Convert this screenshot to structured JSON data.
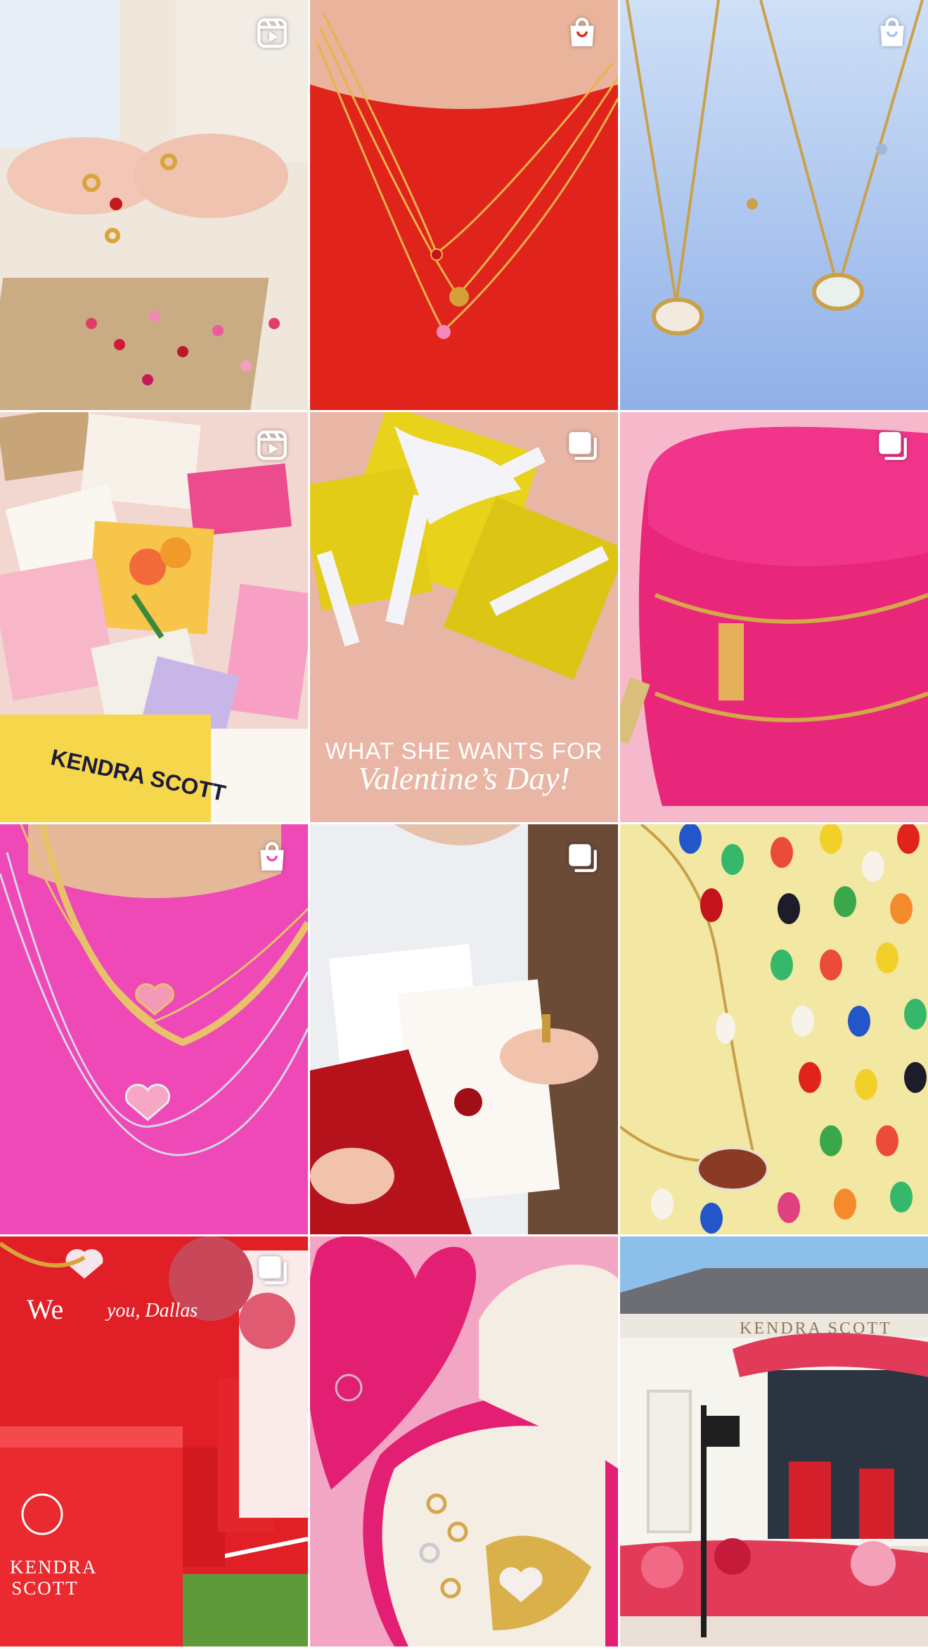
{
  "grid": {
    "tiles": [
      {
        "id": "rings-hands",
        "badge": "reel-icon",
        "colors": {
          "bg": "#efe6dc",
          "accent": "#d9a43a"
        }
      },
      {
        "id": "red-sweater-necklaces",
        "badge": "shopping-bag-icon",
        "colors": {
          "bg": "#e0241c",
          "accent": "#e9b24a"
        }
      },
      {
        "id": "sky-necklaces",
        "badge": "shopping-bag-icon",
        "colors": {
          "bg": "#a7c3ef",
          "accent": "#caa14a"
        }
      },
      {
        "id": "love-letters",
        "badge": "reel-icon",
        "brand_text": "KENDRA SCOTT",
        "colors": {
          "bg": "#f2d7d0",
          "accent": "#ec4b8d"
        }
      },
      {
        "id": "gift-boxes",
        "badge": "carousel-icon",
        "headline": "WHAT SHE WANTS FOR",
        "subheadline": "Valentine’s Day!",
        "colors": {
          "bg": "#e9b5a4",
          "accent": "#e8d21a"
        }
      },
      {
        "id": "pink-heart-case",
        "badge": "carousel-icon",
        "colors": {
          "bg": "#f6b9cb",
          "accent": "#e9277a"
        }
      },
      {
        "id": "pink-shirt-necklaces",
        "badge": "shopping-bag-icon",
        "colors": {
          "bg": "#ee49b6",
          "accent": "#e8c16b"
        }
      },
      {
        "id": "letter-envelope",
        "badge": "carousel-icon",
        "colors": {
          "bg": "#eceef2",
          "accent": "#b5121b"
        }
      },
      {
        "id": "football-necklace",
        "badge": "",
        "colors": {
          "bg": "#f3e7a4",
          "accent": "#8b3a26"
        }
      },
      {
        "id": "dallas-popup",
        "badge": "carousel-icon",
        "sign_text": "We",
        "sign_script": "you, Dallas",
        "brand_logo_text": "KENDRA SCOTT",
        "colors": {
          "bg": "#e11f26",
          "accent": "#ffffff"
        }
      },
      {
        "id": "heart-jewelry-box",
        "badge": "",
        "colors": {
          "bg": "#f3a6c4",
          "accent": "#e21f73"
        }
      },
      {
        "id": "storefront",
        "badge": "",
        "store_sign": "KENDRA SCOTT",
        "colors": {
          "bg": "#8cc0ea",
          "accent": "#e23b5a"
        }
      }
    ]
  }
}
